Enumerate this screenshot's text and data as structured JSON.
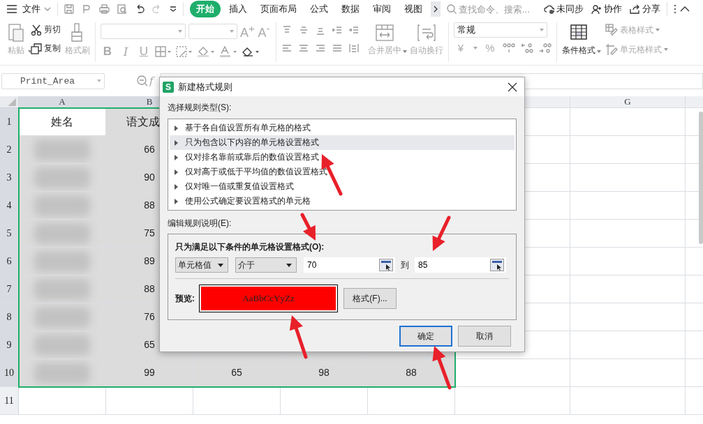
{
  "menu_bar": {
    "file_menu": "文件",
    "tabs": [
      {
        "label": "开始",
        "selected": true
      },
      {
        "label": "插入",
        "selected": false
      },
      {
        "label": "页面布局",
        "selected": false
      },
      {
        "label": "公式",
        "selected": false
      },
      {
        "label": "数据",
        "selected": false
      },
      {
        "label": "审阅",
        "selected": false
      },
      {
        "label": "视图",
        "selected": false
      }
    ],
    "search": {
      "placeholder": "查找命令、搜索..."
    },
    "actions": [
      {
        "kind": "sync",
        "label": "未同步"
      },
      {
        "kind": "collab",
        "label": "协作"
      },
      {
        "kind": "share",
        "label": "分享"
      }
    ]
  },
  "ribbon": {
    "clipboard": [
      {
        "kind": "paste",
        "label": "粘贴",
        "disabled": true
      },
      {
        "kind": "cut",
        "label": "剪切",
        "disabled": false
      },
      {
        "kind": "copy",
        "label": "复制",
        "disabled": false
      },
      {
        "kind": "painter",
        "label": "格式刷",
        "disabled": true
      }
    ],
    "font": {
      "grow": "A$^{+}$",
      "shrink": "A$^{-}$",
      "bold": "B",
      "italic": "I",
      "underline": "U"
    },
    "alignment": [
      {
        "kind": "merge",
        "label": "合并居中",
        "disabled": true
      },
      {
        "kind": "wrap",
        "label": "自动换行",
        "disabled": true
      }
    ],
    "number": {
      "format": "常规",
      "currency": "¥",
      "percent": "%"
    },
    "styles": [
      {
        "kind": "conditional",
        "label": "条件格式",
        "disabled": false
      },
      {
        "kind": "table",
        "label": "表格样式",
        "disabled": true
      },
      {
        "kind": "cell",
        "label": "单元格样式",
        "disabled": true
      }
    ]
  },
  "formula_bar": {
    "name_box": "Print_Area",
    "function_label": "f"
  },
  "sheet": {
    "columns": [
      {
        "label": "A",
        "selected": true
      },
      {
        "label": "B",
        "selected": true
      },
      {
        "selected": true
      },
      {
        "selected": true
      },
      {
        "selected": true
      },
      {
        "selected": false
      },
      {
        "label": "G",
        "selected": false
      }
    ],
    "rows": [
      {
        "number": "1",
        "selected": true,
        "cells": [
          {
            "text": "姓名",
            "active": true
          },
          {
            "text": "语文成"
          }
        ]
      },
      {
        "number": "2",
        "selected": true,
        "cells": [
          {
            "obscured": true
          },
          {
            "text": "66"
          }
        ]
      },
      {
        "number": "3",
        "selected": true,
        "cells": [
          {
            "obscured": true
          },
          {
            "text": "90"
          }
        ]
      },
      {
        "number": "4",
        "selected": true,
        "cells": [
          {
            "obscured": true
          },
          {
            "text": "88"
          }
        ]
      },
      {
        "number": "5",
        "selected": true,
        "cells": [
          {
            "obscured": true
          },
          {
            "text": "75"
          }
        ]
      },
      {
        "number": "6",
        "selected": true,
        "cells": [
          {
            "obscured": true
          },
          {
            "text": "89"
          }
        ]
      },
      {
        "number": "7",
        "selected": true,
        "cells": [
          {
            "obscured": true
          },
          {
            "text": "88"
          }
        ]
      },
      {
        "number": "8",
        "selected": true,
        "cells": [
          {
            "obscured": true
          },
          {
            "text": "76"
          }
        ]
      },
      {
        "number": "9",
        "selected": true,
        "cells": [
          {
            "obscured": true
          },
          {
            "text": "65"
          }
        ]
      },
      {
        "number": "10",
        "selected": true,
        "cells": [
          {
            "obscured": true
          },
          {
            "text": "99"
          },
          {
            "text": "65"
          },
          {
            "text": "98"
          },
          {
            "text": "88"
          }
        ]
      },
      {
        "number": "11",
        "selected": false,
        "cells": []
      }
    ]
  },
  "dialog": {
    "title": "新建格式规则",
    "app_badge": "S",
    "rule_type_label": "选择规则类型(S):",
    "rule_types": [
      {
        "label": "基于各自值设置所有单元格的格式",
        "selected": false
      },
      {
        "label": "只为包含以下内容的单元格设置格式",
        "selected": true
      },
      {
        "label": "仅对排名靠前或靠后的数值设置格式",
        "selected": false
      },
      {
        "label": "仅对高于或低于平均值的数值设置格式",
        "selected": false
      },
      {
        "label": "仅对唯一值或重复值设置格式",
        "selected": false
      },
      {
        "label": "使用公式确定要设置格式的单元格",
        "selected": false
      }
    ],
    "edit_label": "编辑规则说明(E):",
    "condition_title": "只为满足以下条件的单元格设置格式(O):",
    "subject": "单元格值",
    "operator": "介于",
    "min_value": "70",
    "to_label": "到",
    "max_value": "85",
    "preview_label": "预览:",
    "preview_text": "AaBbCcYyZz",
    "format_button": "格式(F)...",
    "buttons": [
      {
        "label": "确定",
        "default": true
      },
      {
        "label": "取消",
        "default": false
      }
    ]
  }
}
